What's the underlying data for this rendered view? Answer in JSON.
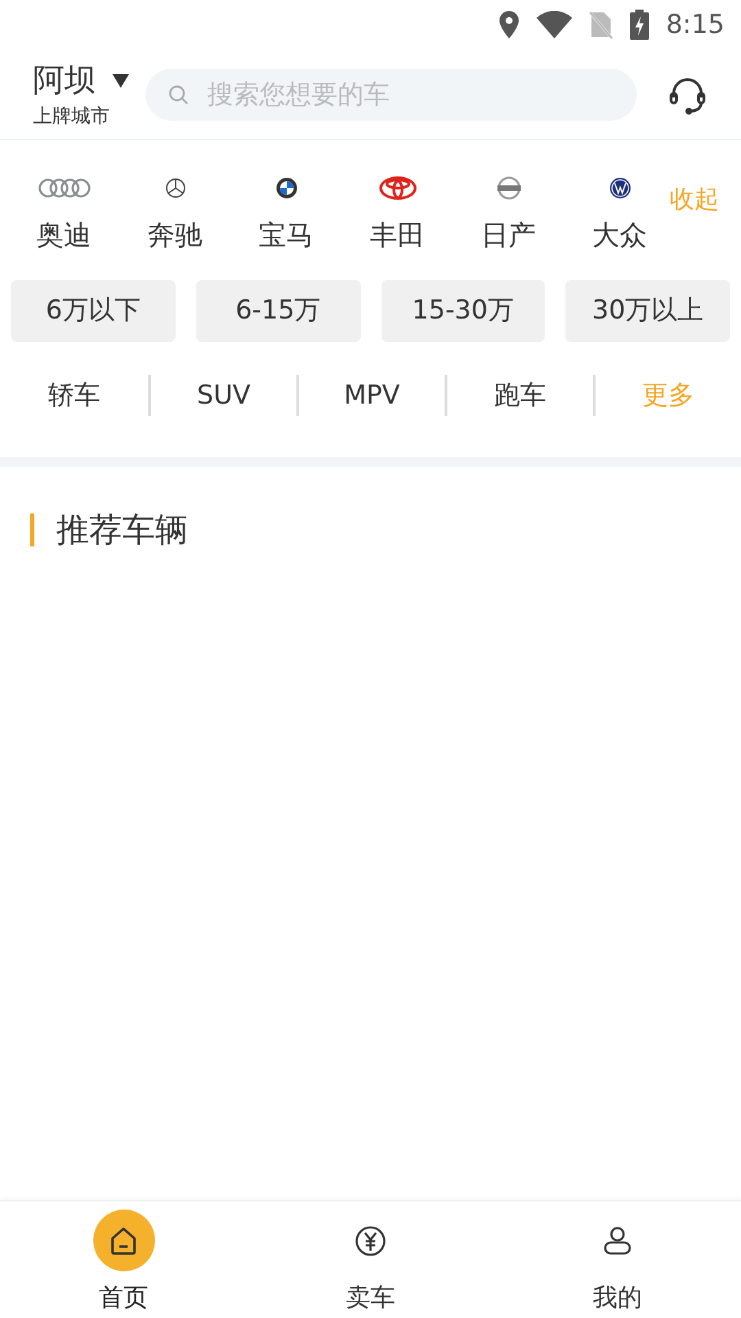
{
  "status_bar": {
    "time": "8:15"
  },
  "header": {
    "city": "阿坝",
    "city_caption": "上牌城市",
    "search": {
      "placeholder": "搜索您想要的车"
    }
  },
  "brands": [
    {
      "label": "奥迪",
      "kind": "rings"
    },
    {
      "label": "奔驰",
      "kind": "star"
    },
    {
      "label": "宝马",
      "kind": "roundel"
    },
    {
      "label": "丰田",
      "kind": "ellipses"
    },
    {
      "label": "日产",
      "kind": "bar"
    },
    {
      "label": "大众",
      "kind": "vw"
    }
  ],
  "brands_toggle": "收起",
  "price_ranges": [
    "6万以下",
    "6-15万",
    "15-30万",
    "30万以上"
  ],
  "body_types": [
    {
      "label": "轿车",
      "kind": "type"
    },
    {
      "label": "SUV",
      "kind": "type"
    },
    {
      "label": "MPV",
      "kind": "type"
    },
    {
      "label": "跑车",
      "kind": "type"
    },
    {
      "label": "更多",
      "kind": "more"
    }
  ],
  "section_title": "推荐车辆",
  "bottom_nav": [
    {
      "label": "首页",
      "kind": "home",
      "selected": true
    },
    {
      "label": "卖车",
      "kind": "yuan",
      "selected": false
    },
    {
      "label": "我的",
      "kind": "user",
      "selected": false
    }
  ]
}
